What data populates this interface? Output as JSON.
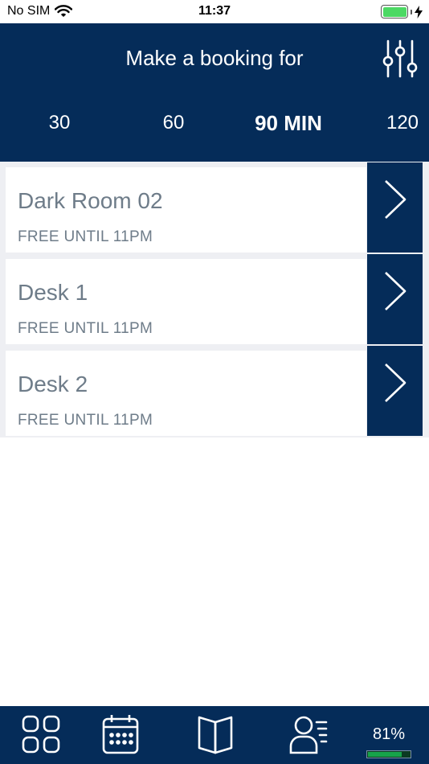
{
  "status_bar": {
    "carrier": "No SIM",
    "time": "11:37",
    "battery_color": "#4cd964"
  },
  "header": {
    "title": "Make a booking for",
    "filter_icon": "sliders-icon",
    "background": "#052c59"
  },
  "durations": [
    {
      "label": "30",
      "selected": false
    },
    {
      "label": "60",
      "selected": false
    },
    {
      "label": "90 MIN",
      "selected": true
    },
    {
      "label": "120",
      "selected": false
    }
  ],
  "rooms": [
    {
      "name": "Dark Room 02",
      "status": "FREE UNTIL 11PM"
    },
    {
      "name": "Desk 1",
      "status": "FREE UNTIL 11PM"
    },
    {
      "name": "Desk 2",
      "status": "FREE UNTIL 11PM"
    }
  ],
  "tabbar": {
    "tabs": [
      {
        "icon": "grid-icon"
      },
      {
        "icon": "calendar-icon"
      },
      {
        "icon": "book-icon"
      },
      {
        "icon": "contacts-icon"
      }
    ],
    "battery_label": "81%",
    "battery_level": 0.81
  }
}
